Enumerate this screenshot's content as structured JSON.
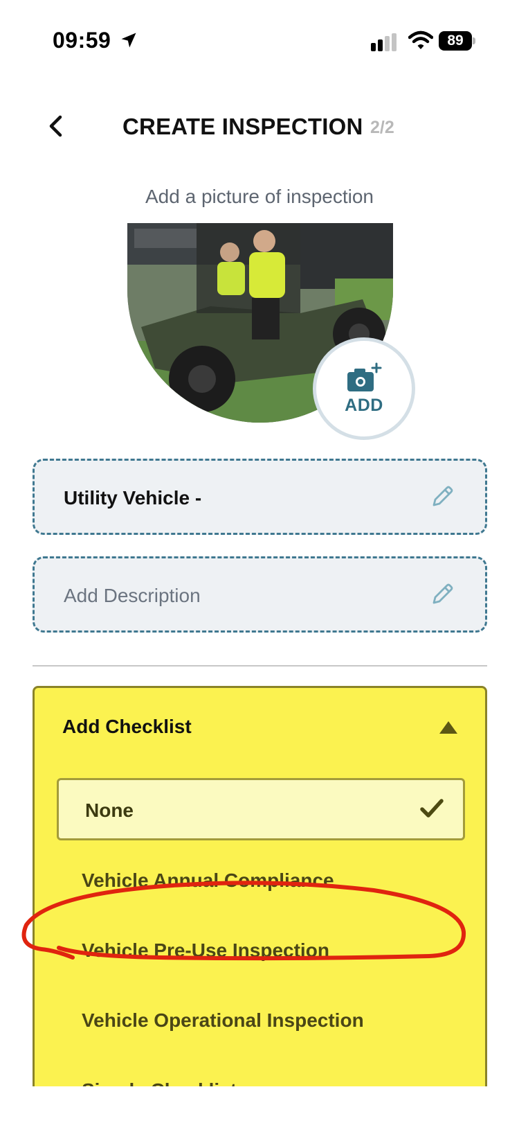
{
  "status_bar": {
    "time": "09:59",
    "battery": "89",
    "icons": [
      "location-arrow-icon",
      "cellular-signal-icon",
      "wifi-icon",
      "battery-icon"
    ]
  },
  "header": {
    "title": "CREATE INSPECTION",
    "step": "2/2",
    "back_icon": "chevron-left-icon"
  },
  "picture": {
    "label": "Add a picture of inspection",
    "add_label": "ADD",
    "add_icon": "camera-plus-icon"
  },
  "fields": {
    "name_value": "Utility Vehicle -",
    "description_placeholder": "Add Description",
    "edit_icon": "pencil-icon"
  },
  "checklist": {
    "title": "Add Checklist",
    "toggle_icon": "caret-up-icon",
    "selected": "None",
    "options": [
      "Vehicle Annual Compliance",
      "Vehicle Pre-Use Inspection",
      "Vehicle Operational Inspection",
      "Simple Checklist"
    ]
  },
  "colors": {
    "accent": "#3f7890",
    "checklist_bg": "#fbf250",
    "annotation": "#e0240f"
  }
}
